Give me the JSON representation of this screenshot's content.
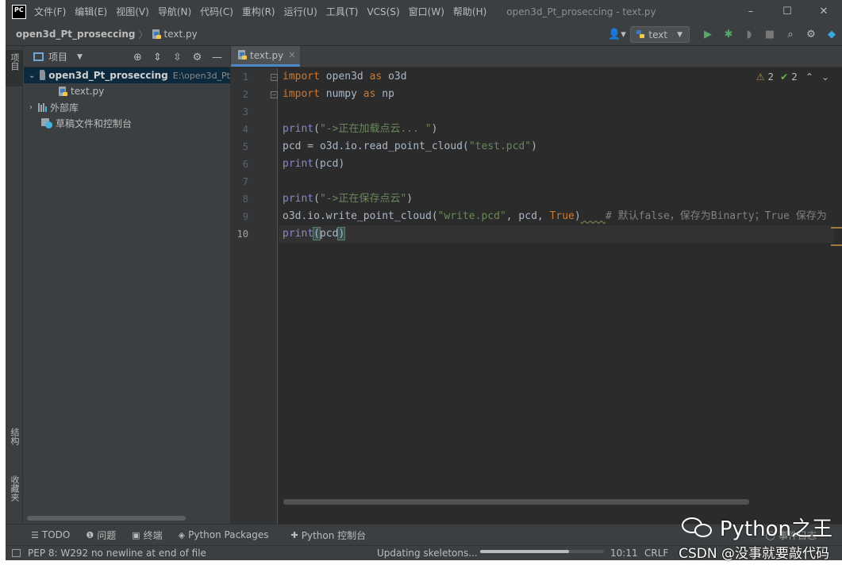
{
  "app": {
    "logo_text": "PC",
    "window_title": "open3d_Pt_proseccing - text.py",
    "window_controls": {
      "minimize": "–",
      "maximize": "☐",
      "close": "✕"
    }
  },
  "menu": [
    "文件(F)",
    "编辑(E)",
    "视图(V)",
    "导航(N)",
    "代码(C)",
    "重构(R)",
    "运行(U)",
    "工具(T)",
    "VCS(S)",
    "窗口(W)",
    "帮助(H)"
  ],
  "breadcrumb": {
    "project": "open3d_Pt_proseccing",
    "separator": "〉",
    "file": "text.py"
  },
  "toolbar": {
    "run_config": "text"
  },
  "left_strip": {
    "project_tab": "项目",
    "structure_tab": "结构",
    "favorites_tab": "收藏夹"
  },
  "project_panel": {
    "title": "项目",
    "tree": [
      {
        "label": "open3d_Pt_proseccing",
        "hint": "E:\\open3d_Pt",
        "kind": "project-root"
      },
      {
        "label": "text.py",
        "kind": "file"
      },
      {
        "label": "外部库",
        "kind": "libraries"
      },
      {
        "label": "草稿文件和控制台",
        "kind": "scratches"
      }
    ]
  },
  "editor": {
    "tab_label": "text.py",
    "line_numbers": [
      "1",
      "2",
      "3",
      "4",
      "5",
      "6",
      "7",
      "8",
      "9",
      "10"
    ],
    "current_line": "10",
    "inspections": {
      "warnings": "2",
      "weak_warnings": "2"
    },
    "code": {
      "l1": {
        "kw1": "import",
        "t1": " open3d ",
        "kw2": "as",
        "t2": " o3d"
      },
      "l2": {
        "kw1": "import",
        "t1": " numpy ",
        "kw2": "as",
        "t2": " np"
      },
      "l4": {
        "fn": "print",
        "p1": "(",
        "str": "\"->正在加载点云... \"",
        "p2": ")"
      },
      "l5": {
        "t1": "pcd = o3d.io.read_point_cloud(",
        "str": "\"test.pcd\"",
        "p2": ")"
      },
      "l6": {
        "fn": "print",
        "t1": "(pcd)"
      },
      "l8": {
        "fn": "print",
        "p1": "(",
        "str": "\"->正在保存点云\"",
        "p2": ")"
      },
      "l9": {
        "t1": "o3d.io.write_point_cloud(",
        "str": "\"write.pcd\"",
        "t2": ", pcd, ",
        "kw": "True",
        "t3": ")",
        "cmt": "# 默认false，保存为Binarty；True 保存为"
      },
      "l10": {
        "fn": "print",
        "p1": "(",
        "arg": "pcd",
        "p2": ")"
      }
    }
  },
  "tool_windows": [
    {
      "icon": "☰",
      "label": "TODO"
    },
    {
      "icon": "❶",
      "label": "问题"
    },
    {
      "icon": "▣",
      "label": "终端"
    },
    {
      "icon": "◈",
      "label": "Python Packages"
    },
    {
      "icon": "✚",
      "label": "Python 控制台"
    }
  ],
  "status": {
    "message": "PEP 8: W292 no newline at end of file",
    "task": "Updating skeletons...",
    "progress": 0.72,
    "position": "10:11",
    "line_sep": "CRLF",
    "event_log": "事件日志"
  },
  "watermark": {
    "text": "Python之王",
    "csdn": "CSDN @没事就要敲代码"
  }
}
